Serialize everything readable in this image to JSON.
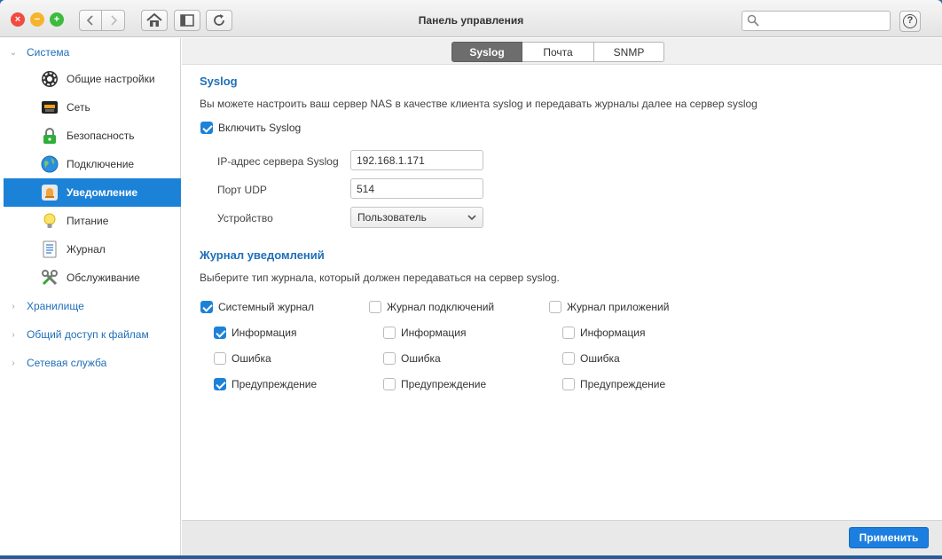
{
  "window": {
    "title": "Панель управления"
  },
  "toolbar": {
    "back_icon": "chevron-left-icon",
    "forward_icon": "chevron-right-icon",
    "home_icon": "home-icon",
    "panel_icon": "sidebar-icon",
    "refresh_icon": "refresh-icon",
    "help_label": "?"
  },
  "search": {
    "value": "",
    "placeholder": ""
  },
  "sidebar": {
    "groups": [
      {
        "label": "Система",
        "expanded": true
      },
      {
        "label": "Хранилище",
        "expanded": false
      },
      {
        "label": "Общий доступ к файлам",
        "expanded": false
      },
      {
        "label": "Сетевая служба",
        "expanded": false
      }
    ],
    "items": [
      {
        "label": "Общие настройки",
        "icon": "gear-icon"
      },
      {
        "label": "Сеть",
        "icon": "network-icon"
      },
      {
        "label": "Безопасность",
        "icon": "lock-icon"
      },
      {
        "label": "Подключение",
        "icon": "globe-icon"
      },
      {
        "label": "Уведомление",
        "icon": "bell-icon",
        "active": true
      },
      {
        "label": "Питание",
        "icon": "lightbulb-icon"
      },
      {
        "label": "Журнал",
        "icon": "log-icon"
      },
      {
        "label": "Обслуживание",
        "icon": "tools-icon"
      }
    ]
  },
  "tabs": [
    {
      "label": "Syslog",
      "active": true
    },
    {
      "label": "Почта",
      "active": false
    },
    {
      "label": "SNMP",
      "active": false
    }
  ],
  "syslog": {
    "title": "Syslog",
    "description": "Вы можете настроить ваш сервер NAS в качестве клиента syslog и передавать журналы далее на сервер syslog",
    "enable_label": "Включить Syslog",
    "enable_checked": true,
    "ip_label": "IP-адрес сервера Syslog",
    "ip_value": "192.168.1.171",
    "port_label": "Порт UDP",
    "port_value": "514",
    "device_label": "Устройство",
    "device_value": "Пользователь"
  },
  "notify": {
    "title": "Журнал уведомлений",
    "description": "Выберите тип журнала, который должен передаваться на сервер syslog.",
    "columns": [
      {
        "label": "Системный журнал",
        "checked": true,
        "options": [
          {
            "label": "Информация",
            "checked": true
          },
          {
            "label": "Ошибка",
            "checked": false
          },
          {
            "label": "Предупреждение",
            "checked": true
          }
        ]
      },
      {
        "label": "Журнал подключений",
        "checked": false,
        "options": [
          {
            "label": "Информация",
            "checked": false
          },
          {
            "label": "Ошибка",
            "checked": false
          },
          {
            "label": "Предупреждение",
            "checked": false
          }
        ]
      },
      {
        "label": "Журнал приложений",
        "checked": false,
        "options": [
          {
            "label": "Информация",
            "checked": false
          },
          {
            "label": "Ошибка",
            "checked": false
          },
          {
            "label": "Предупреждение",
            "checked": false
          }
        ]
      }
    ]
  },
  "footer": {
    "apply_label": "Применить"
  },
  "colors": {
    "accent": "#1c82d8",
    "link": "#1f6fb8",
    "tab_active": "#6d6d6d"
  }
}
